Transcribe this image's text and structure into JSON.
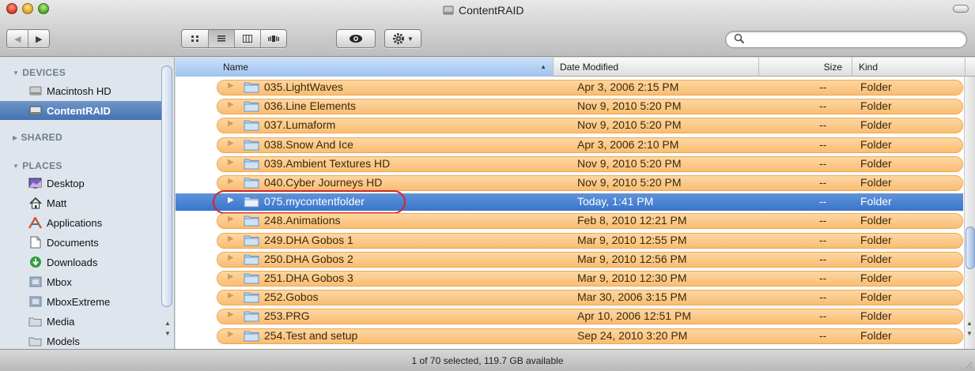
{
  "window": {
    "title": "ContentRAID"
  },
  "search": {
    "placeholder": ""
  },
  "sidebar": {
    "sections": {
      "devices": "DEVICES",
      "shared": "SHARED",
      "places": "PLACES"
    },
    "devices": [
      {
        "label": "Macintosh HD",
        "icon": "hard-drive-icon"
      },
      {
        "label": "ContentRAID",
        "icon": "hard-drive-icon",
        "selected": true
      }
    ],
    "places": [
      {
        "label": "Desktop",
        "icon": "desktop-icon"
      },
      {
        "label": "Matt",
        "icon": "home-icon"
      },
      {
        "label": "Applications",
        "icon": "applications-icon"
      },
      {
        "label": "Documents",
        "icon": "documents-icon"
      },
      {
        "label": "Downloads",
        "icon": "downloads-icon"
      },
      {
        "label": "Mbox",
        "icon": "folder-icon"
      },
      {
        "label": "MboxExtreme",
        "icon": "folder-icon"
      },
      {
        "label": "Media",
        "icon": "folder-icon"
      },
      {
        "label": "Models",
        "icon": "folder-icon"
      }
    ]
  },
  "columns": {
    "name": "Name",
    "date": "Date Modified",
    "size": "Size",
    "kind": "Kind"
  },
  "files": [
    {
      "name": "035.LightWaves",
      "date": "Apr 3, 2006 2:15 PM",
      "size": "--",
      "kind": "Folder"
    },
    {
      "name": "036.Line Elements",
      "date": "Nov 9, 2010 5:20 PM",
      "size": "--",
      "kind": "Folder"
    },
    {
      "name": "037.Lumaform",
      "date": "Nov 9, 2010 5:20 PM",
      "size": "--",
      "kind": "Folder"
    },
    {
      "name": "038.Snow And Ice",
      "date": "Apr 3, 2006 2:10 PM",
      "size": "--",
      "kind": "Folder"
    },
    {
      "name": "039.Ambient Textures HD",
      "date": "Nov 9, 2010 5:20 PM",
      "size": "--",
      "kind": "Folder"
    },
    {
      "name": "040.Cyber Journeys HD",
      "date": "Nov 9, 2010 5:20 PM",
      "size": "--",
      "kind": "Folder"
    },
    {
      "name": "075.mycontentfolder",
      "date": "Today, 1:41 PM",
      "size": "--",
      "kind": "Folder",
      "selected": true
    },
    {
      "name": "248.Animations",
      "date": "Feb 8, 2010 12:21 PM",
      "size": "--",
      "kind": "Folder"
    },
    {
      "name": "249.DHA Gobos 1",
      "date": "Mar 9, 2010 12:55 PM",
      "size": "--",
      "kind": "Folder"
    },
    {
      "name": "250.DHA Gobos 2",
      "date": "Mar 9, 2010 12:56 PM",
      "size": "--",
      "kind": "Folder"
    },
    {
      "name": "251.DHA Gobos 3",
      "date": "Mar 9, 2010 12:30 PM",
      "size": "--",
      "kind": "Folder"
    },
    {
      "name": "252.Gobos",
      "date": "Mar 30, 2006 3:15 PM",
      "size": "--",
      "kind": "Folder"
    },
    {
      "name": "253.PRG",
      "date": "Apr 10, 2006 12:51 PM",
      "size": "--",
      "kind": "Folder"
    },
    {
      "name": "254.Test and setup",
      "date": "Sep 24, 2010 3:20 PM",
      "size": "--",
      "kind": "Folder"
    }
  ],
  "status": {
    "text": "1 of 70 selected, 119.7 GB available"
  },
  "colors": {
    "selection_blue": "#3a76cc",
    "label_orange": "#f9bd72",
    "annotation_red": "#d42626"
  }
}
